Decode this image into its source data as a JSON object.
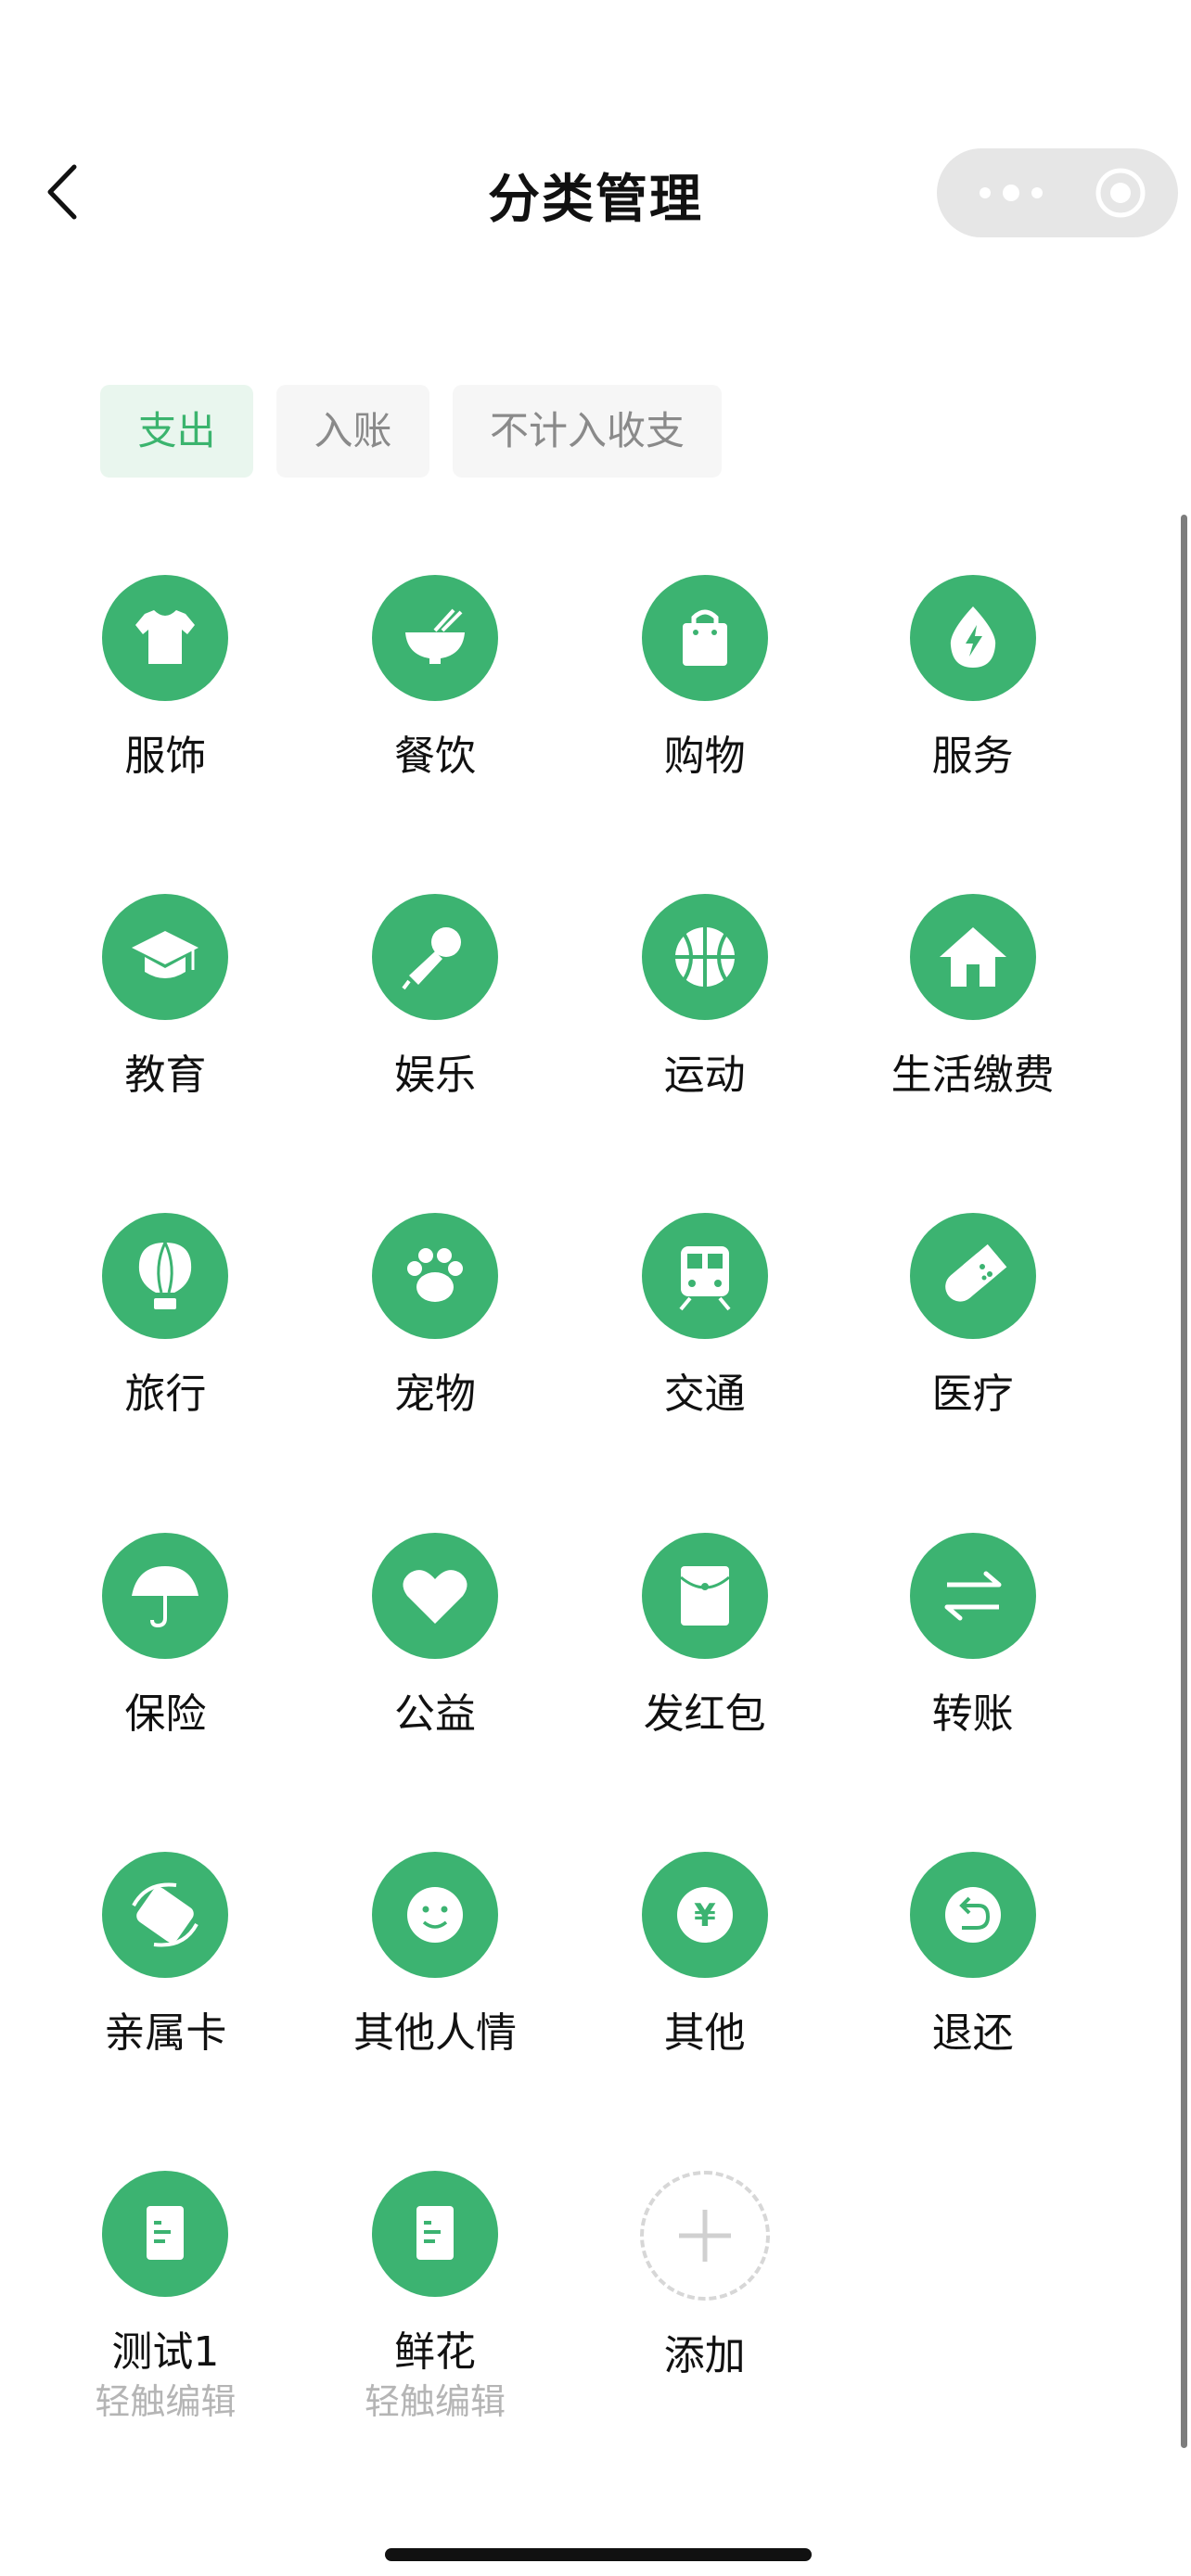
{
  "header": {
    "title": "分类管理"
  },
  "tabs": [
    {
      "label": "支出",
      "active": true
    },
    {
      "label": "入账",
      "active": false
    },
    {
      "label": "不计入收支",
      "active": false
    }
  ],
  "categories": [
    {
      "label": "服饰",
      "icon": "shirt-icon"
    },
    {
      "label": "餐饮",
      "icon": "bowl-icon"
    },
    {
      "label": "购物",
      "icon": "shopping-bag-icon"
    },
    {
      "label": "服务",
      "icon": "service-drop-icon"
    },
    {
      "label": "教育",
      "icon": "graduation-cap-icon"
    },
    {
      "label": "娱乐",
      "icon": "microphone-icon"
    },
    {
      "label": "运动",
      "icon": "basketball-icon"
    },
    {
      "label": "生活缴费",
      "icon": "house-icon"
    },
    {
      "label": "旅行",
      "icon": "hot-air-balloon-icon"
    },
    {
      "label": "宠物",
      "icon": "paw-icon"
    },
    {
      "label": "交通",
      "icon": "train-icon"
    },
    {
      "label": "医疗",
      "icon": "pill-icon"
    },
    {
      "label": "保险",
      "icon": "umbrella-icon"
    },
    {
      "label": "公益",
      "icon": "heart-icon"
    },
    {
      "label": "发红包",
      "icon": "red-envelope-icon"
    },
    {
      "label": "转账",
      "icon": "transfer-arrows-icon"
    },
    {
      "label": "亲属卡",
      "icon": "family-card-icon"
    },
    {
      "label": "其他人情",
      "icon": "smiley-icon"
    },
    {
      "label": "其他",
      "icon": "yen-icon"
    },
    {
      "label": "退还",
      "icon": "return-arrow-icon"
    },
    {
      "label": "测试1",
      "icon": "note-icon",
      "sub": "轻触编辑"
    },
    {
      "label": "鲜花",
      "icon": "note-icon",
      "sub": "轻触编辑"
    }
  ],
  "add": {
    "label": "添加",
    "icon": "plus-icon"
  },
  "colors": {
    "accent": "#3cb371",
    "tab_active_bg": "#e9f6ee",
    "tab_active_text": "#3bb46e"
  }
}
